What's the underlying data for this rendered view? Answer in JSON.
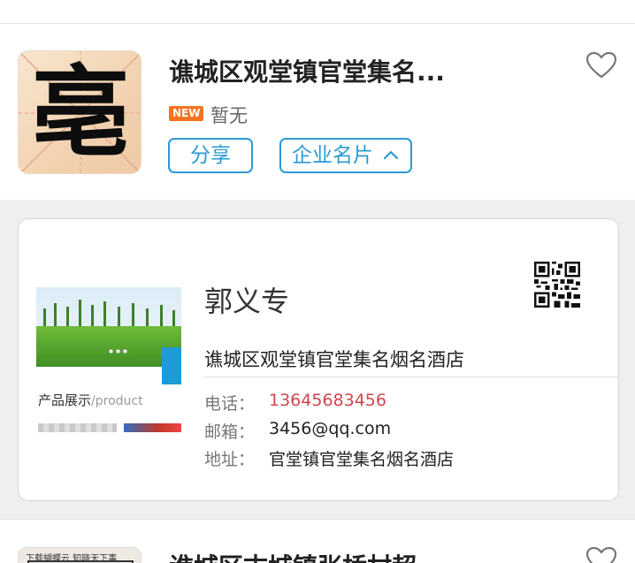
{
  "listing1": {
    "thumbnail_char": "亳",
    "title": "谯城区观堂镇官堂集名...",
    "badge": "NEW",
    "status": "暂无",
    "share_label": "分享",
    "card_label": "企业名片",
    "favorite_icon": "heart-outline-icon"
  },
  "card": {
    "banner_caption": "产品展示",
    "banner_caption_en": "/product",
    "person_name": "郭义专",
    "company": "谯城区观堂镇官堂集名烟名酒店",
    "phone_label": "电话：",
    "phone": "13645683456",
    "email_label": "邮箱：",
    "email": "3456@qq.com",
    "address_label": "地址：",
    "address": "官堂镇官堂集名烟名酒店",
    "qr_icon": "qr-code-icon"
  },
  "listing2": {
    "thumbnail_text": "下载蝴蝶云 知晓天下事",
    "title": "谯城区古城镇张桥村超"
  },
  "colors": {
    "accent": "#2b9ad6",
    "badge": "#f5741f",
    "phone": "#d0454c",
    "band": "#efefef"
  }
}
